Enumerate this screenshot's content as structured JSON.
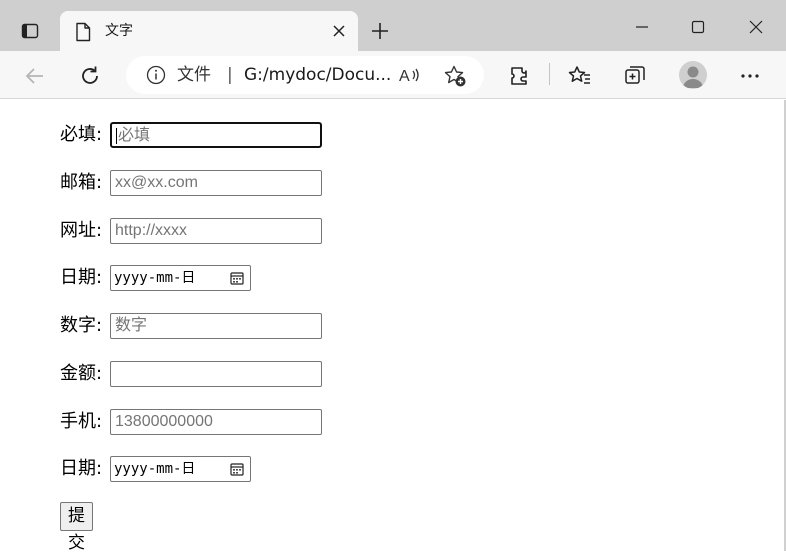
{
  "browser": {
    "tab": {
      "title": "文字",
      "icon": "document-icon"
    },
    "address": {
      "info_label": "文件",
      "separator": "|",
      "url": "G:/mydoc/Docu..."
    },
    "icons": [
      "tab-actions-icon",
      "document-icon",
      "close-icon",
      "plus-icon",
      "minimize-icon",
      "maximize-icon",
      "close-window-icon",
      "back-arrow-icon",
      "refresh-icon",
      "info-icon",
      "read-aloud-icon",
      "add-favorite-icon",
      "extensions-icon",
      "favorites-icon",
      "collections-icon",
      "avatar",
      "more-icon"
    ]
  },
  "form": {
    "fields": [
      {
        "label": "必填:",
        "placeholder": "必填",
        "type": "text",
        "focused": true
      },
      {
        "label": "邮箱:",
        "placeholder": "xx@xx.com",
        "type": "email"
      },
      {
        "label": "网址:",
        "placeholder": "http://xxxx",
        "type": "url"
      },
      {
        "label": "日期:",
        "value": "yyyy-mm-日",
        "type": "date"
      },
      {
        "label": "数字:",
        "placeholder": "数字",
        "type": "number"
      },
      {
        "label": "金额:",
        "placeholder": "",
        "type": "text"
      },
      {
        "label": "手机:",
        "placeholder": "13800000000",
        "type": "tel"
      },
      {
        "label": "日期:",
        "value": "yyyy-mm-日",
        "type": "date"
      }
    ],
    "submit_label": "提交"
  }
}
